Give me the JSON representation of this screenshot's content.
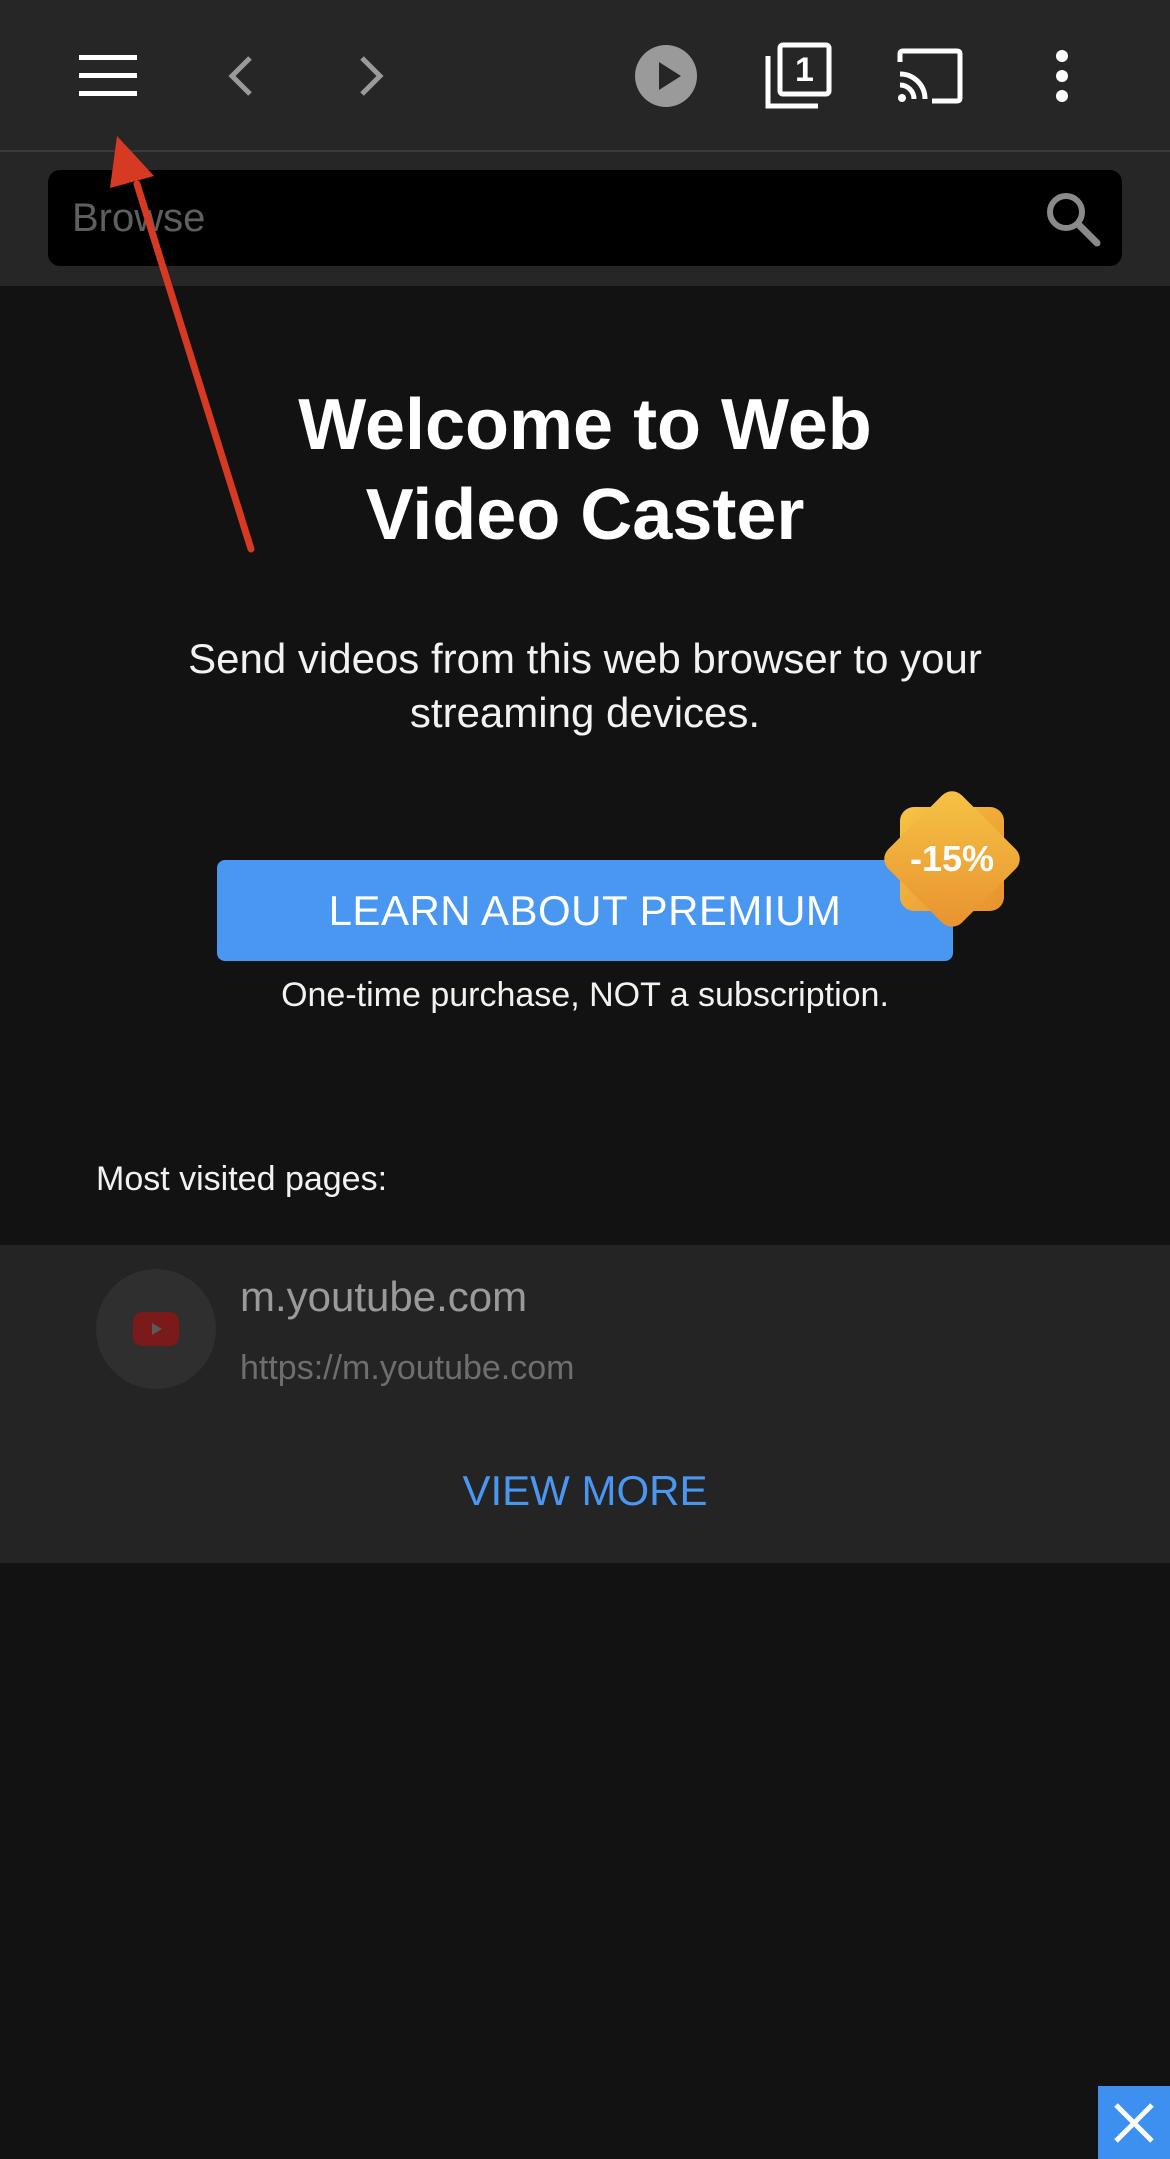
{
  "toolbar": {
    "menu_icon": "hamburger-menu-icon",
    "back_icon": "chevron-left-icon",
    "forward_icon": "chevron-right-icon",
    "play_icon": "play-circle-icon",
    "tabs_icon": "tabs-icon",
    "tabs_count": "1",
    "cast_icon": "cast-icon",
    "more_icon": "more-vertical-icon"
  },
  "search": {
    "placeholder": "Browse",
    "icon": "search-icon"
  },
  "welcome": {
    "title_line1": "Welcome to Web",
    "title_line2": "Video Caster",
    "subtitle": "Send videos from this web browser to your streaming devices."
  },
  "premium": {
    "button_label": "LEARN ABOUT PREMIUM",
    "badge_label": "-15%",
    "note": "One-time purchase, NOT a subscription."
  },
  "most_visited": {
    "heading": "Most visited pages:",
    "items": [
      {
        "title": "m.youtube.com",
        "url": "https://m.youtube.com",
        "icon": "youtube-icon"
      }
    ],
    "view_more_label": "VIEW MORE"
  },
  "overlay": {
    "close_icon": "close-icon",
    "annotation": "red-arrow-pointing-to-menu"
  },
  "colors": {
    "background": "#121212",
    "toolbar": "#262626",
    "accent": "#4a97f2",
    "badge_start": "#f6c445",
    "badge_end": "#e8912f",
    "annotation_arrow": "#d63a22"
  }
}
